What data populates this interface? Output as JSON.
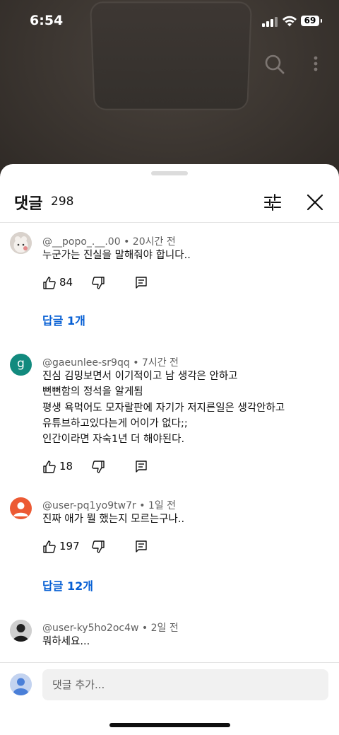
{
  "status": {
    "time": "6:54",
    "battery": "69"
  },
  "sheet": {
    "title": "댓글",
    "count": "298"
  },
  "comments": [
    {
      "author": "@__popo_.__.00",
      "time": "20시간 전",
      "lines": [
        "누군가는 진실을 말해줘야 합니다.."
      ],
      "likes": "84",
      "replies": "답글 1개"
    },
    {
      "author": "@gaeunlee-sr9qq",
      "avatar_letter": "g",
      "time": "7시간 전",
      "lines": [
        "진심 김밍보면서 이기적이고 남 생각은 안하고",
        "뻔뻔함의 정석을 알게됨",
        "평생 욕먹어도 모자랄판에 자기가 저지른일은 생각안하고",
        "유튜브하고있다는게 어이가 없다;;",
        "인간이라면 자숙1년 더 해야된다."
      ],
      "likes": "18"
    },
    {
      "author": "@user-pq1yo9tw7r",
      "time": "1일 전",
      "lines": [
        "진짜 애가 뭘 했는지 모르는구나.."
      ],
      "likes": "197",
      "replies": "답글 12개"
    },
    {
      "author": "@user-ky5ho2oc4w",
      "time": "2일 전",
      "lines": [
        "뭐하세요..."
      ]
    }
  ],
  "composer": {
    "placeholder": "댓글 추가..."
  },
  "separator": "•",
  "colors": {
    "accent": "#065fd4",
    "avatar_green": "#128a7e",
    "avatar_orange": "#ec5a34"
  }
}
